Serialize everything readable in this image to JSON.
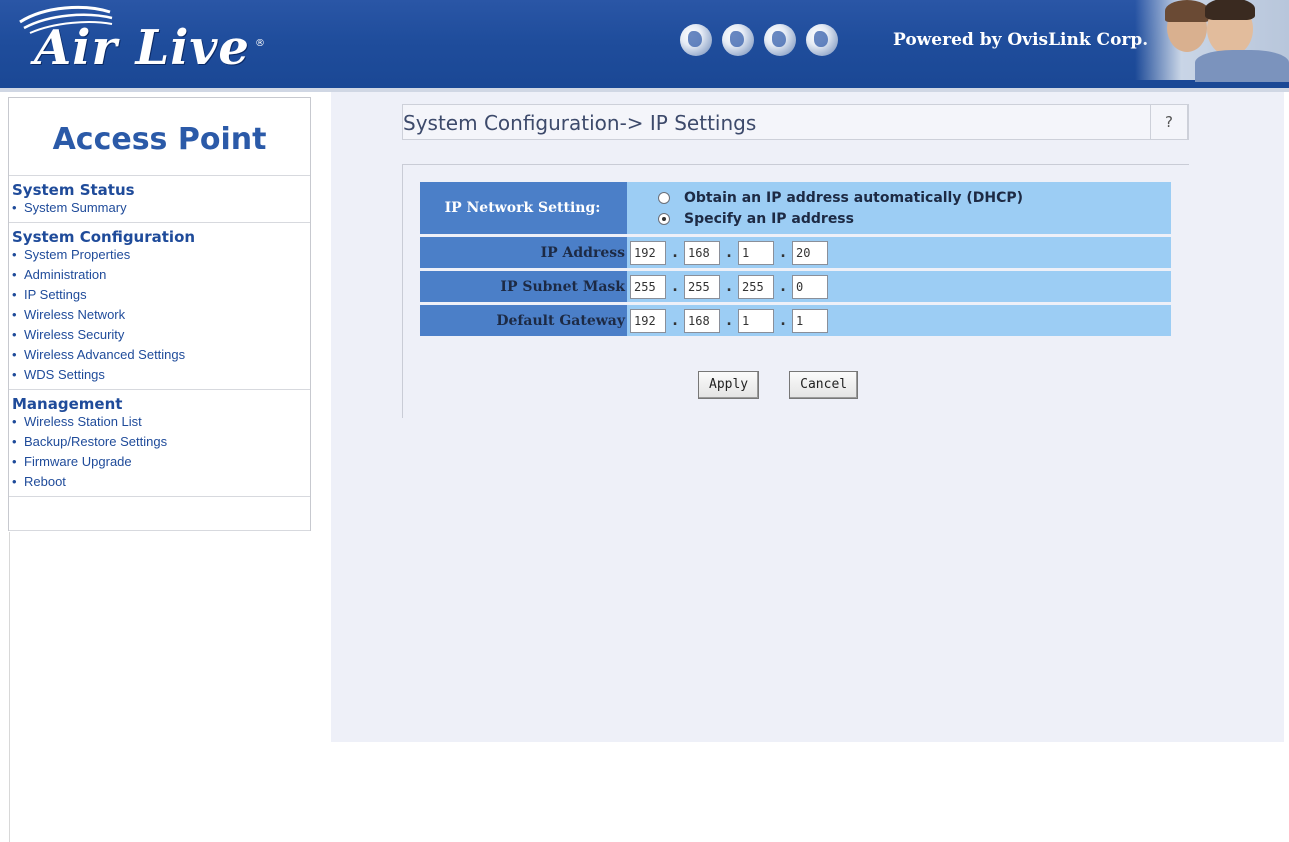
{
  "header": {
    "logo": "Air Live",
    "registered_mark": "®",
    "powered_by": "Powered by OvisLink Corp.",
    "globe_icons": [
      "globe-icon",
      "globe-icon",
      "globe-icon",
      "globe-icon"
    ]
  },
  "sidebar": {
    "title": "Access Point",
    "sections": [
      {
        "heading": "System Status",
        "items": [
          "System Summary"
        ]
      },
      {
        "heading": "System Configuration",
        "items": [
          "System Properties",
          "Administration",
          "IP Settings",
          "Wireless Network",
          "Wireless Security",
          "Wireless Advanced Settings",
          "WDS Settings"
        ]
      },
      {
        "heading": "Management",
        "items": [
          "Wireless Station List",
          "Backup/Restore Settings",
          "Firmware Upgrade",
          "Reboot"
        ]
      }
    ],
    "bullet": "•"
  },
  "main": {
    "title": "System Configuration-> IP Settings",
    "help": "?",
    "network_setting": {
      "label": "IP Network Setting:",
      "options": [
        "Obtain an IP address automatically (DHCP)",
        "Specify an IP address"
      ],
      "selected": 1
    },
    "fields": [
      {
        "label": "IP Address",
        "octets": [
          "192",
          "168",
          "1",
          "20"
        ]
      },
      {
        "label": "IP Subnet Mask",
        "octets": [
          "255",
          "255",
          "255",
          "0"
        ]
      },
      {
        "label": "Default Gateway",
        "octets": [
          "192",
          "168",
          "1",
          "1"
        ]
      }
    ],
    "octet_separator": ".",
    "apply_label": "Apply",
    "cancel_label": "Cancel"
  },
  "colors": {
    "banner": "#1f4d9c",
    "label_cell": "#4b7fc8",
    "value_cell": "#9ccdf4",
    "panel_bg": "#eef0f8",
    "sidebar_text": "#1f4b9a"
  }
}
